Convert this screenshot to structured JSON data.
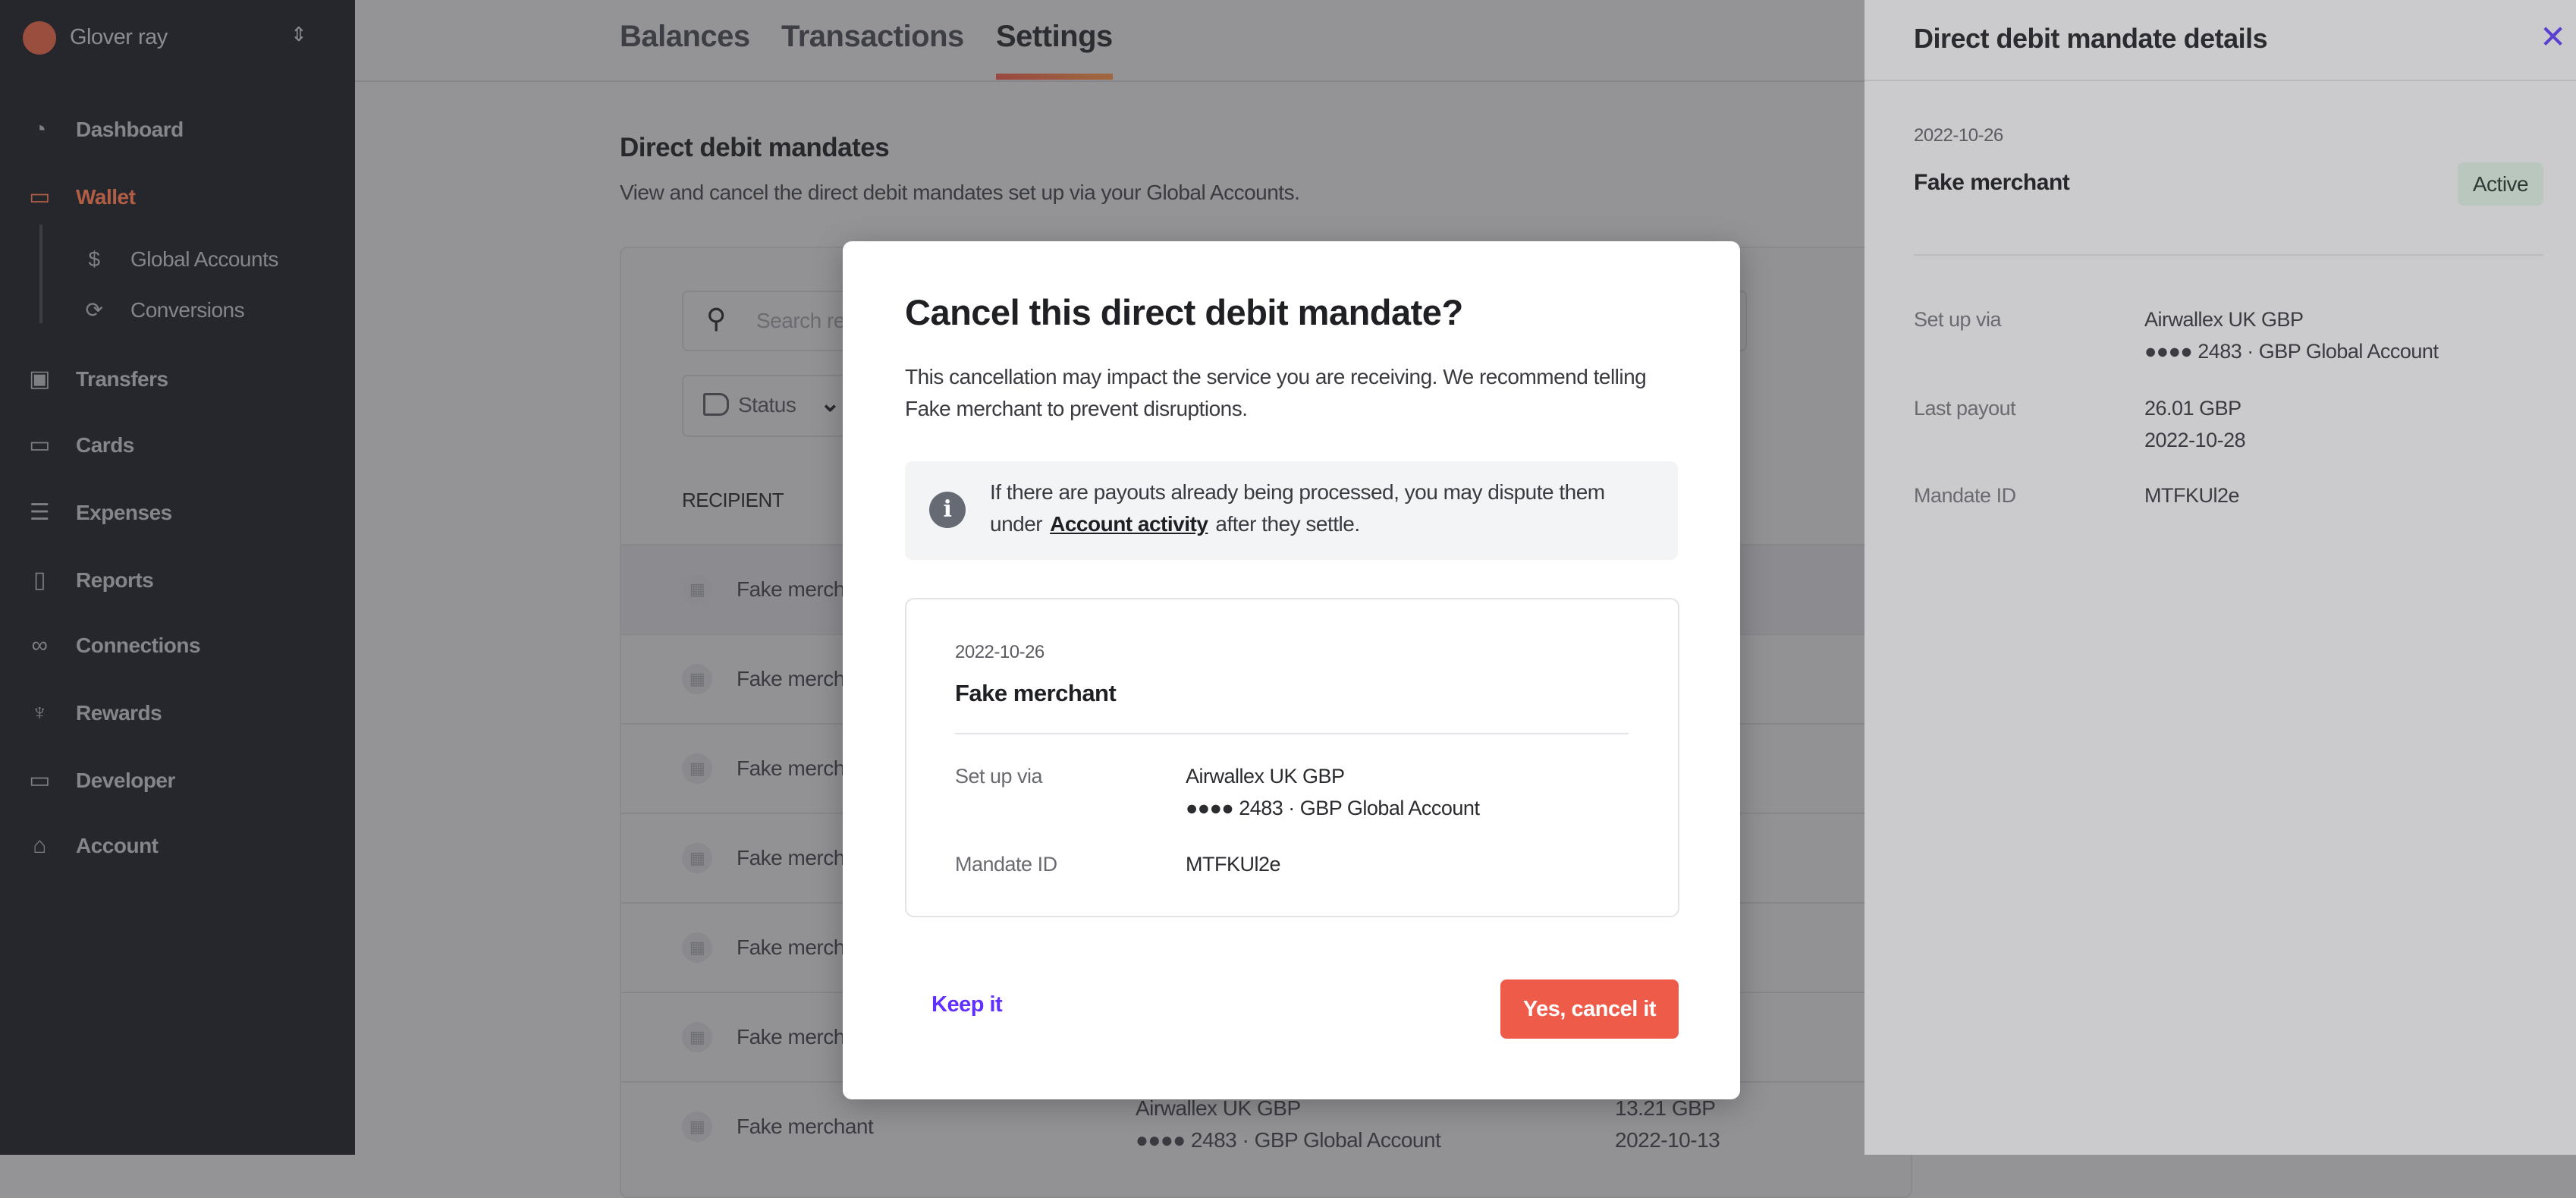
{
  "sidebar": {
    "org_name": "Glover ray",
    "items": [
      {
        "label": "Dashboard",
        "icon": "dashboard-gauge-icon"
      },
      {
        "label": "Wallet",
        "icon": "wallet-icon",
        "active": true
      },
      {
        "label": "Global Accounts",
        "icon": "dollar-circle-icon",
        "sub": true
      },
      {
        "label": "Conversions",
        "icon": "refresh-icon",
        "sub": true
      },
      {
        "label": "Transfers",
        "icon": "banknote-icon"
      },
      {
        "label": "Cards",
        "icon": "card-icon"
      },
      {
        "label": "Expenses",
        "icon": "receipt-icon"
      },
      {
        "label": "Reports",
        "icon": "document-icon"
      },
      {
        "label": "Connections",
        "icon": "link-icon"
      },
      {
        "label": "Rewards",
        "icon": "trophy-icon"
      },
      {
        "label": "Developer",
        "icon": "monitor-icon"
      },
      {
        "label": "Account",
        "icon": "store-icon"
      }
    ],
    "accent": "#b15e45"
  },
  "tabs": [
    "Balances",
    "Transactions",
    "Settings"
  ],
  "active_tab": "Settings",
  "page": {
    "title": "Direct debit mandates",
    "subtitle": "View and cancel the direct debit mandates set up via your Global Accounts.",
    "search_placeholder": "Search re",
    "status_filter": "Status",
    "column_recipient": "RECIPIENT",
    "rows": [
      {
        "recipient": "Fake merch"
      },
      {
        "recipient": "Fake merch"
      },
      {
        "recipient": "Fake merch"
      },
      {
        "recipient": "Fake merch"
      },
      {
        "recipient": "Fake merch"
      },
      {
        "recipient": "Fake merch"
      },
      {
        "recipient": "Fake merchant",
        "account": "Airwallex UK GBP",
        "account_sub": "●●●● 2483 · GBP Global Account",
        "amount": "13.21 GBP",
        "date": "2022-10-13"
      }
    ]
  },
  "drawer": {
    "title": "Direct debit mandate details",
    "date": "2022-10-26",
    "merchant": "Fake merchant",
    "status": "Active",
    "setup_label": "Set up via",
    "setup_value": "Airwallex UK GBP",
    "setup_sub": "●●●● 2483 · GBP Global Account",
    "payout_label": "Last payout",
    "payout_amount": "26.01 GBP",
    "payout_date": "2022-10-28",
    "id_label": "Mandate ID",
    "id_value": "MTFKUl2e"
  },
  "modal": {
    "title": "Cancel this direct debit mandate?",
    "body": "This cancellation may impact the service you are receiving. We recommend telling Fake merchant to prevent disruptions.",
    "info_pre": "If there are payouts already being processed, you may dispute them under",
    "info_link": "Account activity",
    "info_post": "after they settle.",
    "date": "2022-10-26",
    "merchant": "Fake merchant",
    "setup_label": "Set up via",
    "setup_value": "Airwallex UK GBP",
    "setup_sub": "●●●● 2483 · GBP Global Account",
    "id_label": "Mandate ID",
    "id_value": "MTFKUl2e",
    "keep_label": "Keep it",
    "confirm_label": "Yes, cancel it",
    "confirm_color": "#ef5b49",
    "link_color": "#612fff"
  }
}
